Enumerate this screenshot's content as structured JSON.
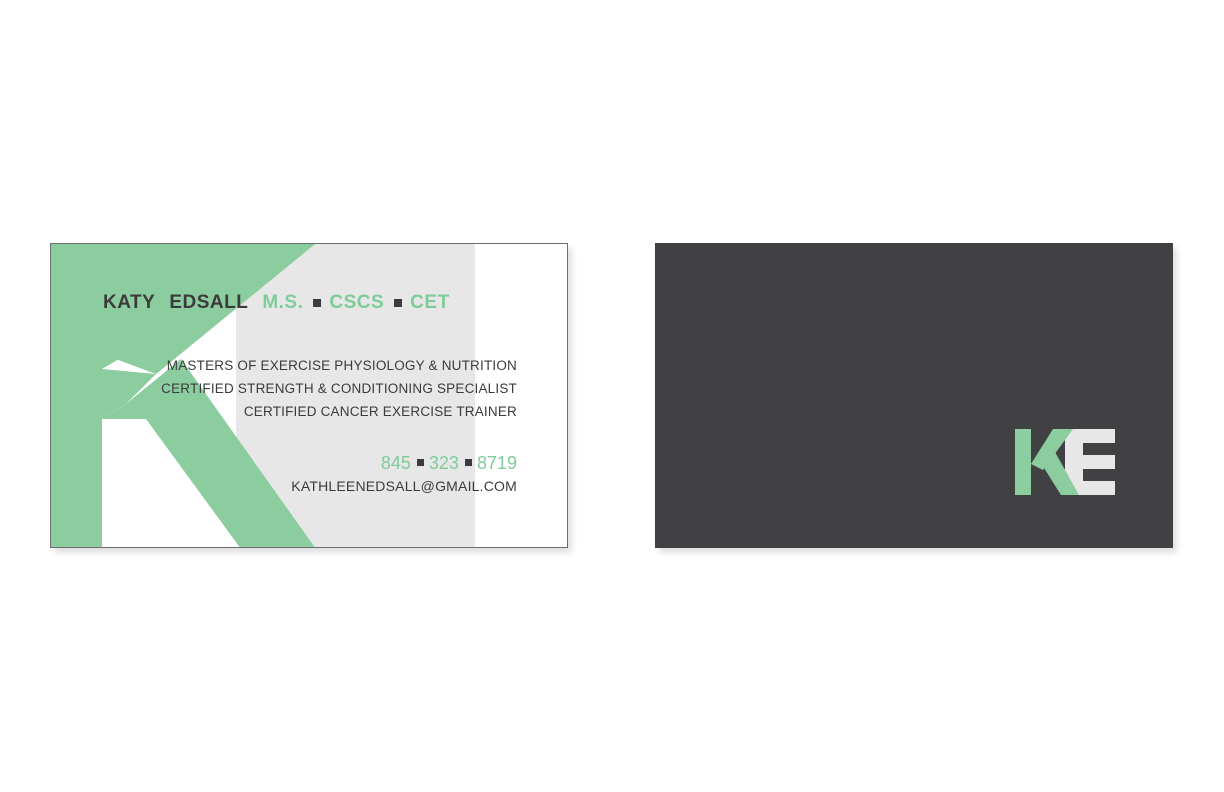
{
  "colors": {
    "green": "#7fcc9a",
    "monogram_green": "#8ccd9f",
    "monogram_gray": "#e6e7e6",
    "dark": "#3b3b3d",
    "back_background": "#414143"
  },
  "front": {
    "name": {
      "first": "KATY",
      "last": "EDSALL",
      "credentials": [
        "M.S.",
        "CSCS",
        "CET"
      ]
    },
    "qualifications": [
      "MASTERS OF EXERCISE PHYSIOLOGY & NUTRITION",
      "CERTIFIED STRENGTH & CONDITIONING SPECIALIST",
      "CERTIFIED CANCER EXERCISE TRAINER"
    ],
    "phone": [
      "845",
      "323",
      "8719"
    ],
    "email": "KATHLEENEDSALL@GMAIL.COM",
    "monogram_icon": "ke-monogram-large"
  },
  "back": {
    "logo_icon": "ke-logo"
  }
}
